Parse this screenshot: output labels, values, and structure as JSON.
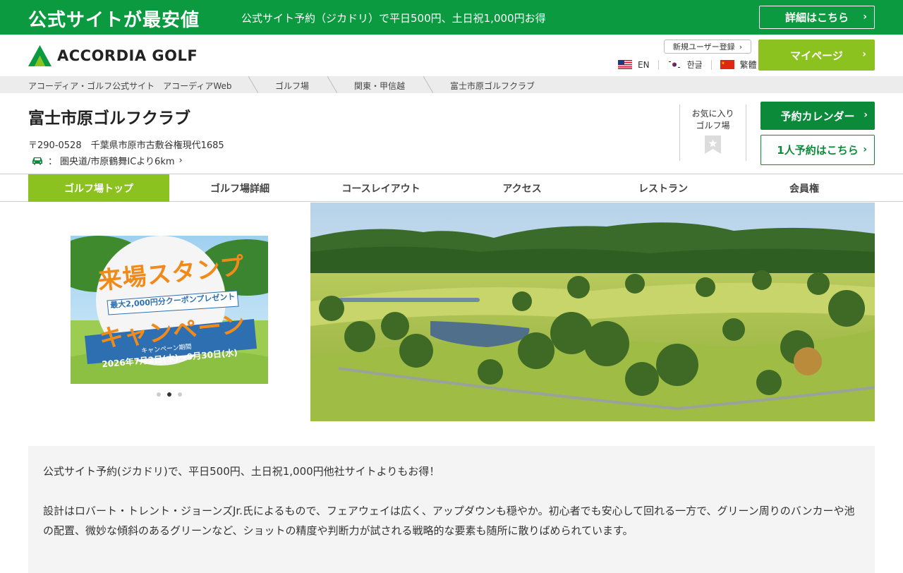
{
  "promo": {
    "title": "公式サイトが最安値",
    "text": "公式サイト予約（ジカドリ）で平日500円、土日祝1,000円お得",
    "button_label": "詳細はこちら"
  },
  "header": {
    "logo_text": "ACCORDIA GOLF",
    "register_label": "新規ユーザー登録",
    "mypage_label": "マイページ",
    "languages": [
      {
        "label": "EN",
        "icon": "us-flag-icon"
      },
      {
        "label": "한글",
        "icon": "kr-flag-icon"
      },
      {
        "label": "繁體",
        "icon": "cn-flag-icon"
      }
    ]
  },
  "breadcrumb": {
    "items": [
      "アコーディア・ゴルフ公式サイト　アコーディアWeb",
      "ゴルフ場",
      "関東・甲信越",
      "富士市原ゴルフクラブ"
    ]
  },
  "course": {
    "name": "富士市原ゴルフクラブ",
    "address": "〒290-0528　千葉県市原市古敷谷権現代1685",
    "access_prefix": "：",
    "access": "圏央道/市原鶴舞ICより6km",
    "favorite_label_1": "お気に入り",
    "favorite_label_2": "ゴルフ場",
    "reserve_calendar_label": "予約カレンダー",
    "solo_reserve_label": "1人予約はこちら"
  },
  "tabs": [
    {
      "label": "ゴルフ場トップ",
      "active": true
    },
    {
      "label": "ゴルフ場詳細",
      "active": false
    },
    {
      "label": "コースレイアウト",
      "active": false
    },
    {
      "label": "アクセス",
      "active": false
    },
    {
      "label": "レストラン",
      "active": false
    },
    {
      "label": "会員権",
      "active": false
    }
  ],
  "banner": {
    "title_1": "来場スタンプ",
    "subtitle": "最大2,000円分クーポンプレゼント",
    "title_2": "キャンペーン",
    "period_label": "キャンペーン期間",
    "period": "2026年7月2日(木)～9月30日(水)",
    "slide_count": 3,
    "active_slide": 2
  },
  "description": {
    "p1": "公式サイト予約(ジカドリ)で、平日500円、土日祝1,000円他社サイトよりもお得！",
    "p2": "設計はロバート・トレント・ジョーンズJr.氏によるもので、フェアウェイは広く、アップダウンも穏やか。初心者でも安心して回れる一方で、グリーン周りのバンカーや池の配置、微妙な傾斜のあるグリーンなど、ショットの精度や判断力が試される戦略的な要素も随所に散りばめられています。"
  },
  "colors": {
    "brand_green": "#0b9a3f",
    "accent_lime": "#8cc21f",
    "button_green": "#0b8a3a"
  }
}
